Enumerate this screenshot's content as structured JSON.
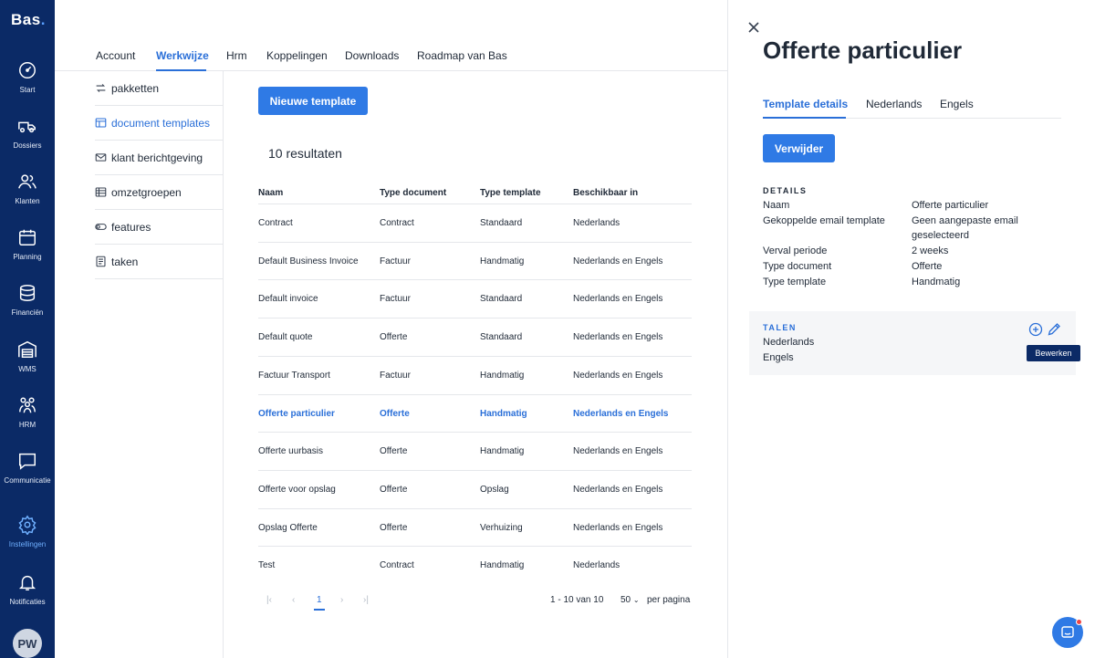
{
  "app": {
    "logo": "Bas",
    "logo_dot": "."
  },
  "rail": {
    "items": [
      {
        "label": "Start",
        "icon": "dashboard-icon"
      },
      {
        "label": "Dossiers",
        "icon": "truck-icon"
      },
      {
        "label": "Klanten",
        "icon": "users-icon"
      },
      {
        "label": "Planning",
        "icon": "calendar-icon"
      },
      {
        "label": "Financiën",
        "icon": "coins-icon"
      },
      {
        "label": "WMS",
        "icon": "warehouse-icon"
      },
      {
        "label": "HRM",
        "icon": "people-icon"
      },
      {
        "label": "Communicatie",
        "icon": "chat-icon"
      },
      {
        "label": "Instellingen",
        "icon": "gear-icon"
      },
      {
        "label": "Notificaties",
        "icon": "bell-icon"
      }
    ],
    "avatar": "PW"
  },
  "topnav": {
    "tabs": [
      "Account",
      "Werkwijze",
      "Hrm",
      "Koppelingen",
      "Downloads",
      "Roadmap van Bas"
    ],
    "active": "Werkwijze"
  },
  "submenu": {
    "items": [
      {
        "label": "pakketten",
        "icon": "packages-icon"
      },
      {
        "label": "document templates",
        "icon": "template-icon"
      },
      {
        "label": "klant berichtgeving",
        "icon": "envelope-icon"
      },
      {
        "label": "omzetgroepen",
        "icon": "table-icon"
      },
      {
        "label": "features",
        "icon": "toggle-icon"
      },
      {
        "label": "taken",
        "icon": "tasks-icon"
      }
    ],
    "active": "document templates"
  },
  "main": {
    "new_button": "Nieuwe template",
    "results": "10 resultaten",
    "columns": [
      "Naam",
      "Type document",
      "Type template",
      "Beschikbaar in"
    ],
    "rows": [
      [
        "Contract",
        "Contract",
        "Standaard",
        "Nederlands"
      ],
      [
        "Default Business Invoice",
        "Factuur",
        "Handmatig",
        "Nederlands en Engels"
      ],
      [
        "Default invoice",
        "Factuur",
        "Standaard",
        "Nederlands en Engels"
      ],
      [
        "Default quote",
        "Offerte",
        "Standaard",
        "Nederlands en Engels"
      ],
      [
        "Factuur Transport",
        "Factuur",
        "Handmatig",
        "Nederlands en Engels"
      ],
      [
        "Offerte particulier",
        "Offerte",
        "Handmatig",
        "Nederlands en Engels"
      ],
      [
        "Offerte uurbasis",
        "Offerte",
        "Handmatig",
        "Nederlands en Engels"
      ],
      [
        "Offerte voor opslag",
        "Offerte",
        "Opslag",
        "Nederlands en Engels"
      ],
      [
        "Opslag Offerte",
        "Offerte",
        "Verhuizing",
        "Nederlands en Engels"
      ],
      [
        "Test",
        "Contract",
        "Handmatig",
        "Nederlands"
      ]
    ],
    "selected_row": "Offerte particulier",
    "pagination": {
      "current_page": "1",
      "range": "1 - 10 van 10",
      "page_size": "50",
      "per_page": "per pagina"
    }
  },
  "panel": {
    "title": "Offerte particulier",
    "tabs": [
      "Template details",
      "Nederlands",
      "Engels"
    ],
    "delete_button": "Verwijder",
    "details_heading": "DETAILS",
    "details": {
      "naam_label": "Naam",
      "naam_value": "Offerte particulier",
      "email_label": "Gekoppelde email template",
      "email_value_1": "Geen aangepaste email",
      "email_value_2": "geselecteerd",
      "verval_label": "Verval periode",
      "verval_value": "2 weeks",
      "typedoc_label": "Type document",
      "typedoc_value": "Offerte",
      "typetpl_label": "Type template",
      "typetpl_value": "Handmatig"
    },
    "talen_heading": "TALEN",
    "talen": [
      "Nederlands",
      "Engels"
    ],
    "tooltip": "Bewerken"
  }
}
